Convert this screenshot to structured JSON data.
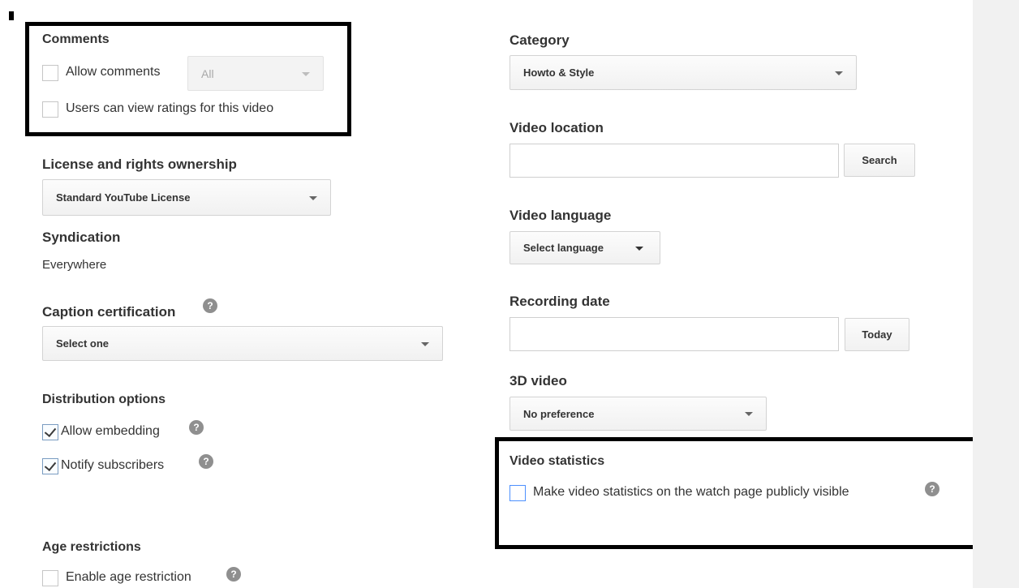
{
  "left": {
    "comments": {
      "heading": "Comments",
      "allow_label": "Allow comments",
      "allow_checked": false,
      "filter_value": "All",
      "ratings_label": "Users can view ratings for this video",
      "ratings_checked": false
    },
    "license": {
      "heading": "License and rights ownership",
      "value": "Standard YouTube License"
    },
    "syndication": {
      "heading": "Syndication",
      "value": "Everywhere"
    },
    "caption": {
      "heading": "Caption certification",
      "value": "Select one"
    },
    "distribution": {
      "heading": "Distribution options",
      "embedding_label": "Allow embedding",
      "embedding_checked": true,
      "notify_label": "Notify subscribers",
      "notify_checked": true
    },
    "age": {
      "heading": "Age restrictions",
      "label": "Enable age restriction",
      "checked": false
    }
  },
  "right": {
    "category": {
      "heading": "Category",
      "value": "Howto & Style"
    },
    "location": {
      "heading": "Video location",
      "input_value": "",
      "button": "Search"
    },
    "language": {
      "heading": "Video language",
      "value": "Select language"
    },
    "recording": {
      "heading": "Recording date",
      "input_value": "",
      "button": "Today"
    },
    "three_d": {
      "heading": "3D video",
      "value": "No preference"
    },
    "statistics": {
      "heading": "Video statistics",
      "label": "Make video statistics on the watch page publicly visible",
      "checked": false
    }
  },
  "icons": {
    "help": "?"
  },
  "colors": {
    "highlight_border": "#000000",
    "sidebar": "#f1f1f1",
    "help_icon": "#8f8f8f",
    "checkbox_focus": "#4d90fe"
  }
}
